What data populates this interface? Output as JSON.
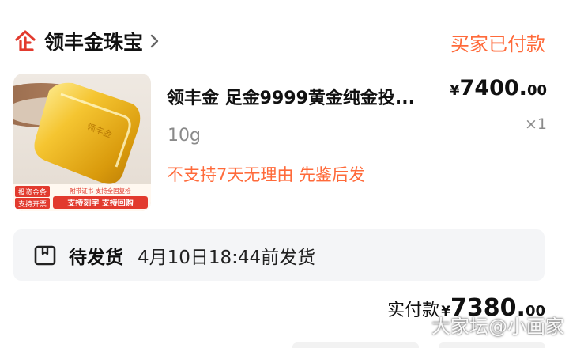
{
  "store": {
    "name": "领丰金珠宝",
    "icon": "store-logo-icon",
    "status": "买家已付款"
  },
  "product": {
    "title": "领丰金 足金9999黄金纯金投...",
    "price_currency": "¥",
    "price_int": "7400.",
    "price_dec": "00",
    "spec": "10g",
    "quantity": "×1",
    "service": "不支持7天无理由   先鉴后发",
    "image_badges": {
      "left_1": "投资金条",
      "left_2": "支持开票",
      "note": "附带证书 支持全国复检",
      "right": "支持刻字 支持回购"
    }
  },
  "shipping": {
    "icon": "package-box-icon",
    "status": "待发货",
    "deadline": "4月10日18:44前发货"
  },
  "payment": {
    "label": "实付款",
    "currency": "¥",
    "amount_int": "7380.",
    "amount_dec": "00"
  },
  "watermark": "大家坛@小画家",
  "colors": {
    "accent": "#ff6a3a",
    "brand_red": "#e23a2e",
    "gray_text": "#8a8a8a",
    "card_bg": "#f4f5f7"
  }
}
